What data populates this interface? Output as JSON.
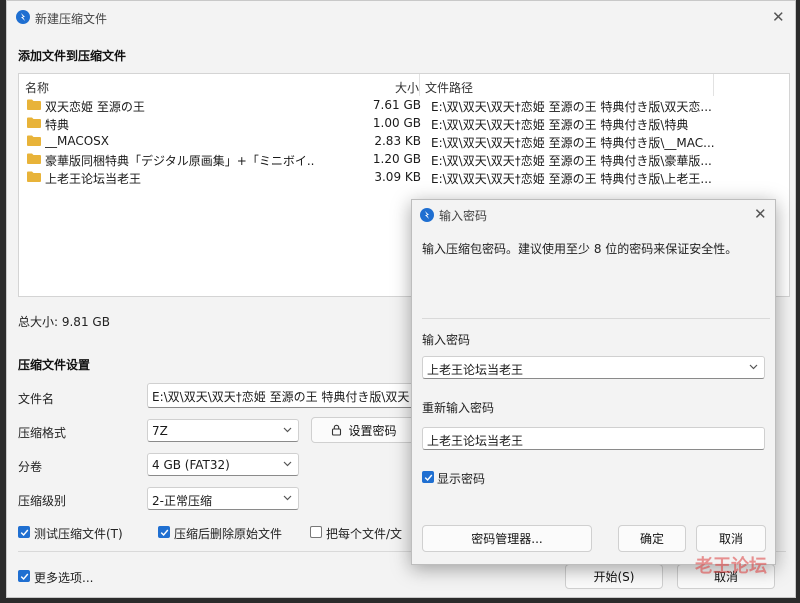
{
  "main": {
    "title": "新建压缩文件",
    "add_section_title": "添加文件到压缩文件",
    "columns": {
      "name": "名称",
      "size": "大小",
      "path": "文件路径"
    },
    "files": [
      {
        "name": "双天恋姫 至源の王",
        "size": "7.61 GB",
        "path": "E:\\双\\双天\\双天†恋姫 至源の王 特典付き版\\双天恋..."
      },
      {
        "name": "特典",
        "size": "1.00 GB",
        "path": "E:\\双\\双天\\双天†恋姫 至源の王 特典付き版\\特典"
      },
      {
        "name": "__MACOSX",
        "size": "2.83 KB",
        "path": "E:\\双\\双天\\双天†恋姫 至源の王 特典付き版\\__MAC..."
      },
      {
        "name": "豪華版同梱特典「デジタル原画集」+「ミニボイ...",
        "size": "1.20 GB",
        "path": "E:\\双\\双天\\双天†恋姫 至源の王 特典付き版\\豪華版..."
      },
      {
        "name": "上老王论坛当老王",
        "size": "3.09 KB",
        "path": "E:\\双\\双天\\双天†恋姫 至源の王 特典付き版\\上老王..."
      }
    ],
    "total_size": "总大小: 9.81 GB",
    "settings_title": "压缩文件设置",
    "filename_label": "文件名",
    "filename_value": "E:\\双\\双天\\双天†恋姫 至源の王 特典付き版\\双天",
    "format_label": "压缩格式",
    "format_value": "7Z",
    "set_password_label": "设置密码",
    "volume_label": "分卷",
    "volume_value": "4 GB (FAT32)",
    "level_label": "压缩级别",
    "level_value": "2-正常压缩",
    "test_label": "测试压缩文件(T)",
    "delete_label": "压缩后删除原始文件",
    "each_label": "把每个文件/文",
    "more_label": "更多选项...",
    "start_label": "开始(S)",
    "cancel_label": "取消"
  },
  "dialog": {
    "title": "输入密码",
    "description": "输入压缩包密码。建议使用至少 8 位的密码来保证安全性。",
    "password_label": "输入密码",
    "password_value": "上老王论坛当老王",
    "repeat_label": "重新输入密码",
    "repeat_value": "上老王论坛当老王",
    "show_password_label": "显示密码",
    "manager_label": "密码管理器...",
    "ok_label": "确定",
    "cancel_label": "取消"
  },
  "watermark": "老王论坛",
  "colors": {
    "accent": "#1f6fd1",
    "folder": "#e8b339"
  },
  "icons": {
    "app": "bandizip-icon",
    "folder": "folder-icon",
    "lock": "lock-icon",
    "close": "close-icon",
    "check": "check-icon",
    "chevron": "chevron-down-icon"
  }
}
